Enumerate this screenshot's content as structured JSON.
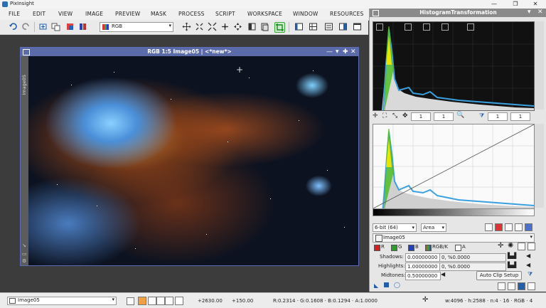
{
  "app": {
    "title": "PixInsight",
    "win_controls": [
      "—",
      "❐",
      "✕"
    ]
  },
  "menu": [
    "FILE",
    "EDIT",
    "VIEW",
    "IMAGE",
    "PREVIEW",
    "MASK",
    "PROCESS",
    "SCRIPT",
    "WORKSPACE",
    "WINDOW",
    "RESOURCES"
  ],
  "toolbar": {
    "channel_select": "RGB"
  },
  "image_window": {
    "title": "RGB 1:5 Image05 | <*new*>",
    "side_label": "Image05",
    "controls": [
      "—",
      "▾",
      "✚",
      "✕"
    ]
  },
  "histogram": {
    "title": "HistogramTransformation",
    "upper_spins": [
      "1",
      "1"
    ],
    "upper_spins_right": [
      "1",
      "1"
    ],
    "format_select": "6-bit (64)",
    "area_select": "Area",
    "view_select": "Image05",
    "channels": {
      "r": "R",
      "g": "G",
      "b": "B",
      "rgbk": "RGB/K",
      "a": "A"
    },
    "shadows": {
      "label": "Shadows:",
      "value": "0.00000000",
      "info": "0, %0.0000"
    },
    "highlights": {
      "label": "Highlights:",
      "value": "1.00000000",
      "info": "0, %0.0000"
    },
    "midtones": {
      "label": "Midtones:",
      "value": "0.50000000"
    },
    "auto_clip_button": "Auto Clip Setup"
  },
  "status": {
    "view": "Image05",
    "x": "+2630.00",
    "y": "+150.00",
    "pixel": "R:0.2314 · G:0.1608 · B:0.1294 · A:1.0000",
    "info": "w:4096 · h:2588 · n:4 · 16 · RGB · 4"
  },
  "colors": {
    "image_title": "#5b6aa9",
    "hist_blue": "#3ba0e0",
    "hist_green": "#55c020",
    "hist_yellow": "#e6e600"
  }
}
